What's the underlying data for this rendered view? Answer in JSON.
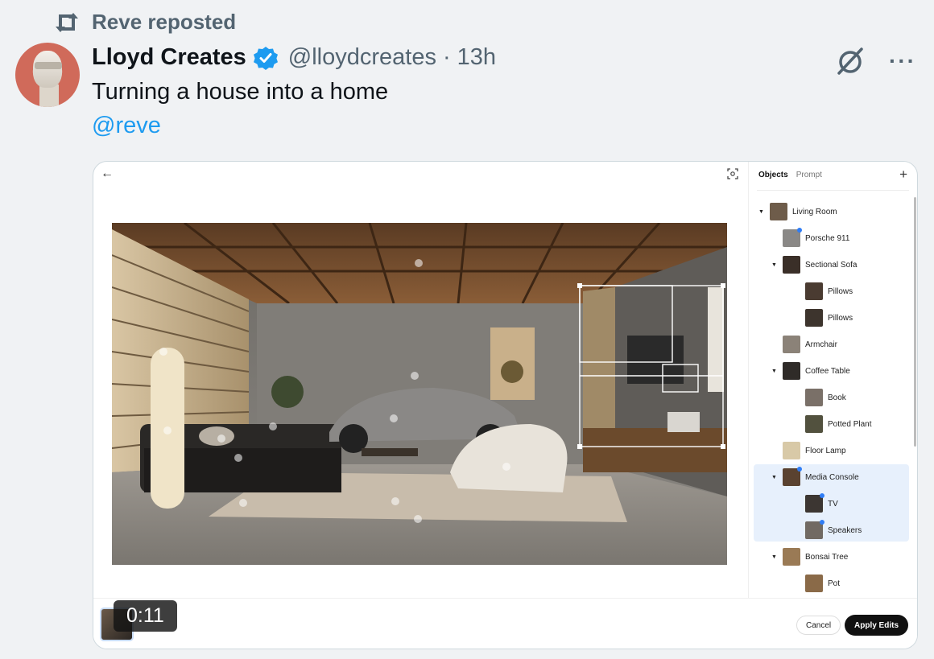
{
  "repost": {
    "label": "Reve reposted",
    "icon": "repost-icon"
  },
  "author": {
    "name": "Lloyd Creates",
    "handle": "@lloydcreates",
    "separator": "·",
    "time": "13h",
    "verified_color": "#1d9bf0"
  },
  "tweet": {
    "text": "Turning a house into a home",
    "mention": "@reve"
  },
  "actions": {
    "grok_icon": "grok-icon",
    "more_label": "···"
  },
  "editor": {
    "back_label": "←",
    "tabs": {
      "objects": "Objects",
      "prompt": "Prompt"
    },
    "add_label": "+",
    "tree": [
      {
        "label": "Living Room",
        "depth": 0,
        "caret": "▼"
      },
      {
        "label": "Porsche 911",
        "depth": 1
      },
      {
        "label": "Sectional Sofa",
        "depth": 1,
        "caret": "▼"
      },
      {
        "label": "Pillows",
        "depth": 2
      },
      {
        "label": "Pillows",
        "depth": 2
      },
      {
        "label": "Armchair",
        "depth": 1
      },
      {
        "label": "Coffee Table",
        "depth": 1,
        "caret": "▼"
      },
      {
        "label": "Book",
        "depth": 2
      },
      {
        "label": "Potted Plant",
        "depth": 2
      },
      {
        "label": "Floor Lamp",
        "depth": 1
      },
      {
        "label": "Media Console",
        "depth": 1,
        "caret": "▼",
        "selected": true
      },
      {
        "label": "TV",
        "depth": 2,
        "selected": true
      },
      {
        "label": "Speakers",
        "depth": 2,
        "selected": true
      },
      {
        "label": "Bonsai Tree",
        "depth": 1,
        "caret": "▼"
      },
      {
        "label": "Pot",
        "depth": 2
      }
    ],
    "cancel_label": "Cancel",
    "apply_label": "Apply Edits"
  },
  "video": {
    "timestamp": "0:11"
  },
  "colors": {
    "accent": "#1d9bf0",
    "selection": "#2f7df6",
    "muted": "#536471"
  }
}
